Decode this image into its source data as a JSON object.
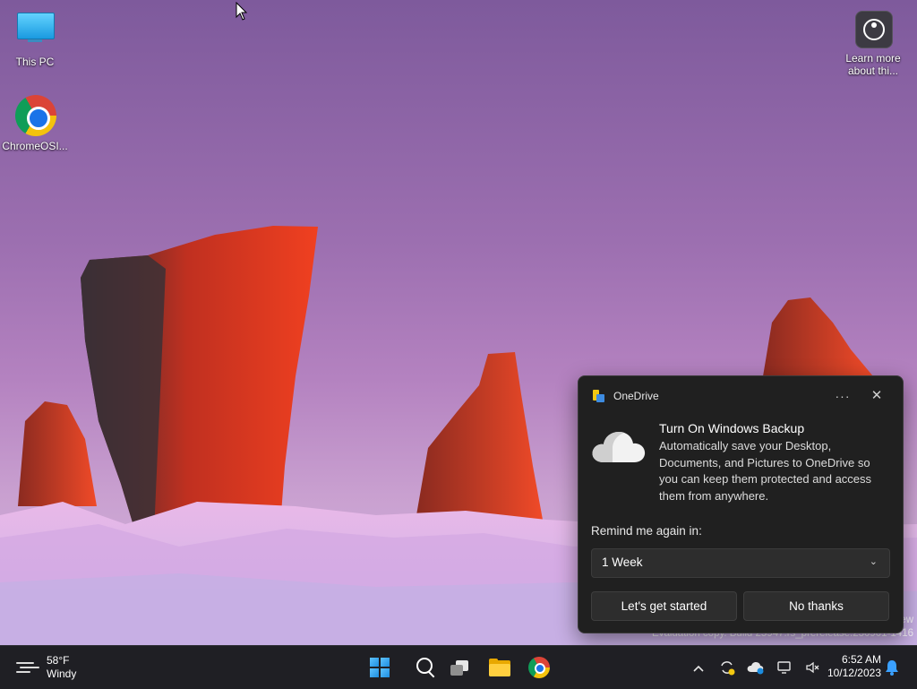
{
  "desktop": {
    "icons": [
      {
        "label": "This PC",
        "icon": "monitor-icon"
      },
      {
        "label": "ChromeOSI...",
        "icon": "chrome-icon"
      },
      {
        "label": "Learn more about thi...",
        "icon": "learn-more-icon"
      }
    ],
    "watermark": {
      "line1": "ew",
      "line2": "Evaluation copy. Build 25947.rs_prerelease.230901-1416"
    }
  },
  "notification": {
    "app_name": "OneDrive",
    "more_label": "···",
    "close_label": "✕",
    "title": "Turn On Windows Backup",
    "body": "Automatically save your Desktop, Documents, and Pictures to OneDrive so you can keep them protected and access them from anywhere.",
    "remind_label": "Remind me again in:",
    "remind_value": "1 Week",
    "primary_button": "Let's get started",
    "secondary_button": "No thanks"
  },
  "taskbar": {
    "weather": {
      "temp": "58°F",
      "condition": "Windy"
    },
    "apps": [
      "start-icon",
      "search-icon",
      "task-view-icon",
      "file-explorer-icon",
      "chrome-icon"
    ],
    "tray": {
      "chevron": "^"
    },
    "clock": {
      "time": "6:52 AM",
      "date": "10/12/2023"
    }
  },
  "colors": {
    "toast_bg": "#202020",
    "taskbar_bg": "#1f1f24",
    "accent": "#1c8de0"
  }
}
